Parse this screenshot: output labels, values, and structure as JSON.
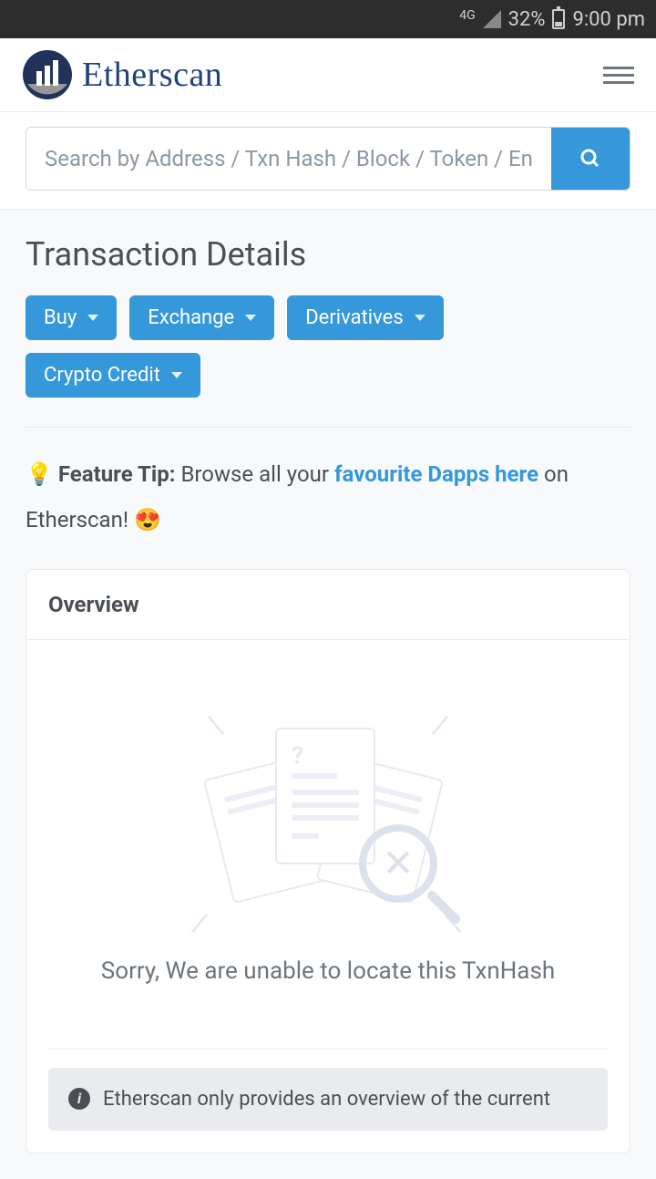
{
  "status_bar": {
    "network": "4G",
    "battery_pct": "32%",
    "time": "9:00 pm"
  },
  "header": {
    "brand": "Etherscan"
  },
  "search": {
    "placeholder": "Search by Address / Txn Hash / Block / Token / Ens"
  },
  "page": {
    "title": "Transaction Details"
  },
  "pills": [
    {
      "label": "Buy"
    },
    {
      "label": "Exchange"
    },
    {
      "label": "Derivatives"
    },
    {
      "label": "Crypto Credit"
    }
  ],
  "tip": {
    "icon": "💡",
    "label": "Feature Tip:",
    "pre": "Browse all your",
    "link": "favourite Dapps here",
    "post": "on Etherscan!",
    "emoji": "😍"
  },
  "card": {
    "header": "Overview",
    "empty_text": "Sorry, We are unable to locate this TxnHash",
    "footnote": "Etherscan only provides an overview of the current"
  }
}
